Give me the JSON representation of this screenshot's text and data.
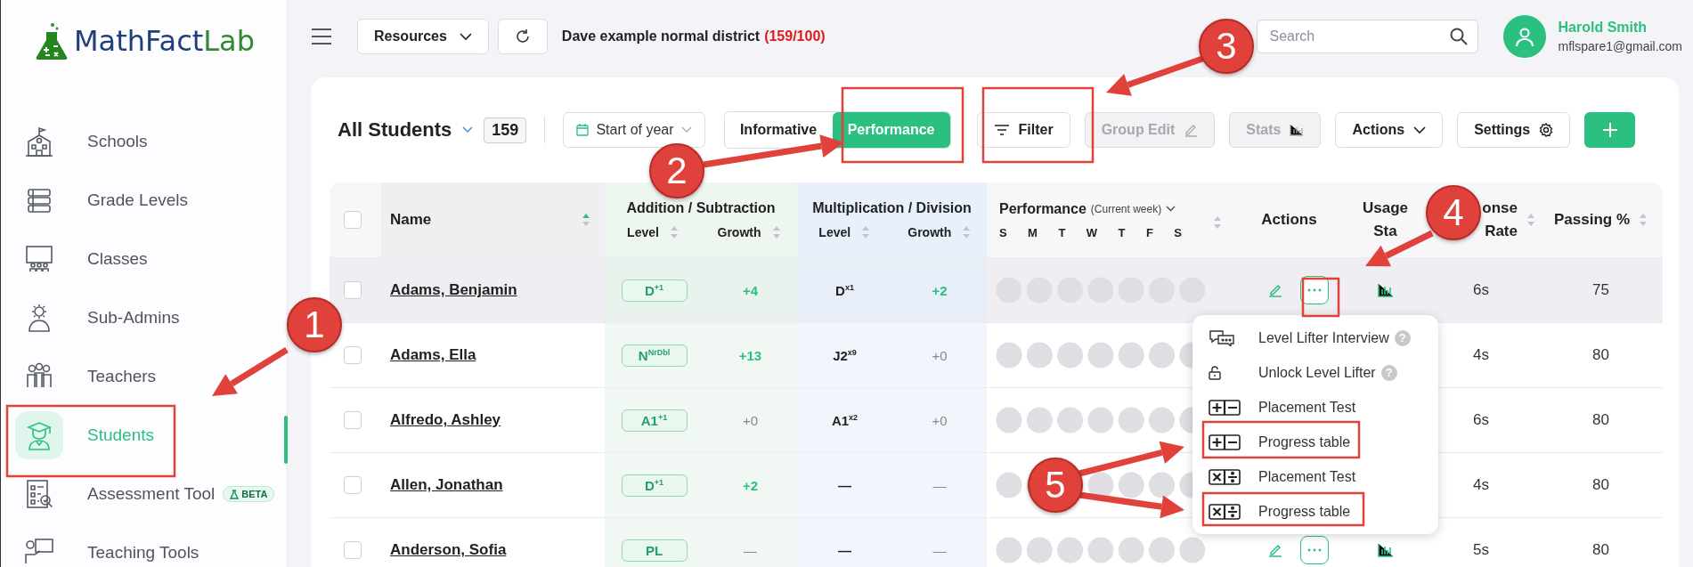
{
  "brand": {
    "name_main": "MathFact",
    "name_accent": "Lab"
  },
  "sidebar": {
    "items": [
      {
        "label": "Schools",
        "kind": "school",
        "selected": false
      },
      {
        "label": "Grade Levels",
        "kind": "grades",
        "selected": false
      },
      {
        "label": "Classes",
        "kind": "classes",
        "selected": false
      },
      {
        "label": "Sub-Admins",
        "kind": "subadmins",
        "selected": false
      },
      {
        "label": "Teachers",
        "kind": "teachers",
        "selected": false
      },
      {
        "label": "Students",
        "kind": "students",
        "selected": true
      },
      {
        "label": "Assessment Tool",
        "kind": "assessment",
        "selected": false,
        "badge": "BETA"
      },
      {
        "label": "Teaching Tools",
        "kind": "teaching",
        "selected": false
      }
    ]
  },
  "header": {
    "resources_button": "Resources",
    "district": "Dave example normal district",
    "district_count": "(159/100)",
    "search": {
      "placeholder": "Search"
    },
    "user": {
      "name": "Harold Smith",
      "email": "mflspare1@gmail.com"
    }
  },
  "toolbar": {
    "title": "All Students",
    "count": "159",
    "date_filter": "Start of year",
    "view_toggle": [
      {
        "label": "Informative",
        "selected": false
      },
      {
        "label": "Performance",
        "selected": true
      }
    ],
    "buttons": [
      {
        "label": "Filter",
        "kind": "filter",
        "disabled": false
      },
      {
        "label": "Group Edit",
        "kind": "edit",
        "disabled": true
      },
      {
        "label": "Stats",
        "kind": "stats",
        "disabled": true
      },
      {
        "label": "Actions",
        "kind": "dropdown",
        "disabled": false
      },
      {
        "label": "Settings",
        "kind": "settings",
        "disabled": false
      }
    ]
  },
  "table": {
    "select_all_checked": false,
    "columns": {
      "name": "Name",
      "groups": [
        {
          "title": "Addition / Subtraction",
          "kind": "addsub",
          "sub": [
            "Level",
            "Growth"
          ]
        },
        {
          "title": "Multiplication / Division",
          "kind": "muldiv",
          "sub": [
            "Level",
            "Growth"
          ]
        }
      ],
      "performance": "Performance",
      "performance_period": "(Current week)",
      "days": [
        "S",
        "M",
        "T",
        "W",
        "T",
        "F",
        "S"
      ],
      "actions": "Actions",
      "usage": [
        "Usage",
        "Sta"
      ],
      "response": [
        "onse",
        "Rate"
      ],
      "passing": "Passing %"
    },
    "rows": [
      {
        "name": "Adams, Benjamin",
        "checked": false,
        "hovered": true,
        "add_level": "D$^{+1}$",
        "add_growth": {
          "text": "+4",
          "positive": true
        },
        "mul_level": "D$^{x1}$",
        "mul_growth": {
          "text": "+2",
          "positive": true
        },
        "actions_shown": true,
        "response": "6s",
        "passing": "75"
      },
      {
        "name": "Adams, Ella",
        "checked": false,
        "hovered": false,
        "add_level": "N$^{NrDbl}$",
        "add_growth": {
          "text": "+13",
          "positive": true
        },
        "mul_level": "J2$^{x9}$",
        "mul_growth": {
          "text": "+0",
          "positive": false
        },
        "response": "4s",
        "passing": "80"
      },
      {
        "name": "Alfredo, Ashley",
        "checked": false,
        "hovered": false,
        "add_level": "A1$^{+1}$",
        "add_growth": {
          "text": "+0",
          "positive": false
        },
        "mul_level": "A1$^{x2}$",
        "mul_growth": {
          "text": "+0",
          "positive": false
        },
        "response": "6s",
        "passing": "80"
      },
      {
        "name": "Allen, Jonathan",
        "checked": false,
        "hovered": false,
        "add_level": "D$^{+1}$",
        "add_growth": {
          "text": "+2",
          "positive": true
        },
        "mul_level": "—",
        "mul_growth": {
          "text": "—",
          "positive": false
        },
        "response": "4s",
        "passing": "80"
      },
      {
        "name": "Anderson, Sofia",
        "checked": false,
        "hovered": false,
        "add_level": "PL",
        "add_growth": {
          "text": "—",
          "positive": false
        },
        "mul_level": "—",
        "mul_growth": {
          "text": "—",
          "positive": false
        },
        "actions_shown": true,
        "response": "5s",
        "passing": "80"
      }
    ]
  },
  "actions_menu": {
    "items": [
      {
        "label": "Level Lifter Interview",
        "kind": "interview",
        "help": "?"
      },
      {
        "label": "Unlock Level Lifter",
        "kind": "unlock",
        "help": "?"
      },
      {
        "label": "Placement Test",
        "kind": "addsub"
      },
      {
        "label": "Progress table",
        "kind": "addsub"
      },
      {
        "label": "Placement Test",
        "kind": "muldiv"
      },
      {
        "label": "Progress table",
        "kind": "muldiv"
      }
    ]
  },
  "annotations": {
    "callouts": [
      "1",
      "2",
      "3",
      "4",
      "5"
    ]
  }
}
